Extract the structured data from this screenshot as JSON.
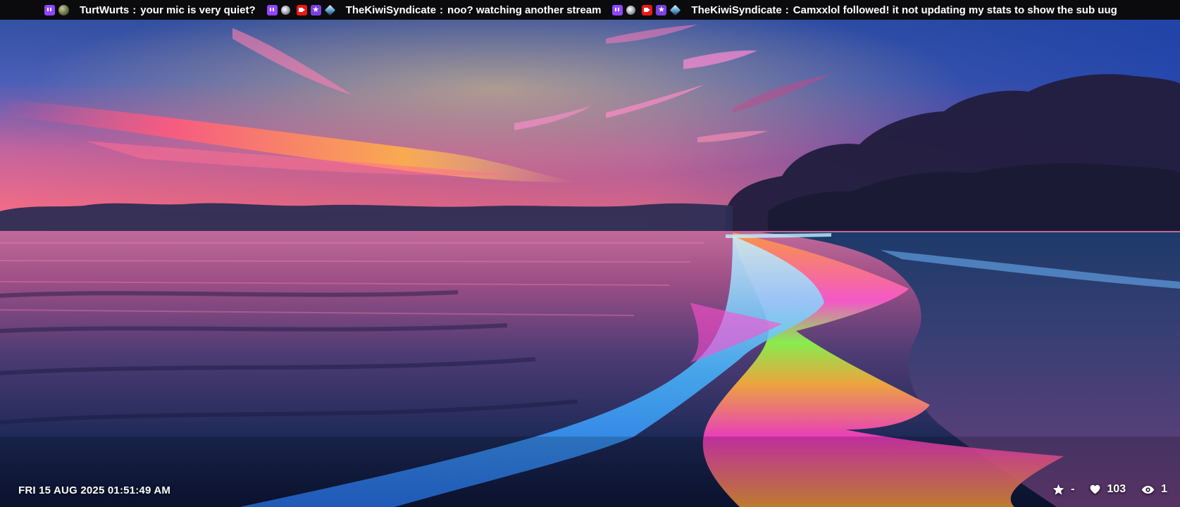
{
  "ticker": {
    "messages": [
      {
        "badges": [
          "twitch-icon",
          "orb-icon"
        ],
        "username": "TurtWurts",
        "separator": ":",
        "text": "your mic is very quiet?"
      },
      {
        "badges": [
          "twitch-icon",
          "kiwi-icon",
          "video-icon",
          "star-icon",
          "gem-icon"
        ],
        "username": "TheKiwiSyndicate",
        "separator": ":",
        "text": "noo?  watching another stream"
      },
      {
        "badges": [
          "twitch-icon",
          "kiwi-icon",
          "video-icon",
          "star-icon",
          "gem-icon"
        ],
        "username": "TheKiwiSyndicate",
        "separator": ":",
        "text": "Camxxlol followed!  it not updating my stats to show the sub uug"
      }
    ]
  },
  "status": {
    "datetime": "FRI 15 AUG 2025 01:51:49 AM",
    "star_value": "-",
    "likes": "103",
    "viewers": "1"
  },
  "colors": {
    "ticker_bg": "#0b0b0d",
    "twitch_purple": "#9146ff",
    "text": "#ffffff"
  }
}
